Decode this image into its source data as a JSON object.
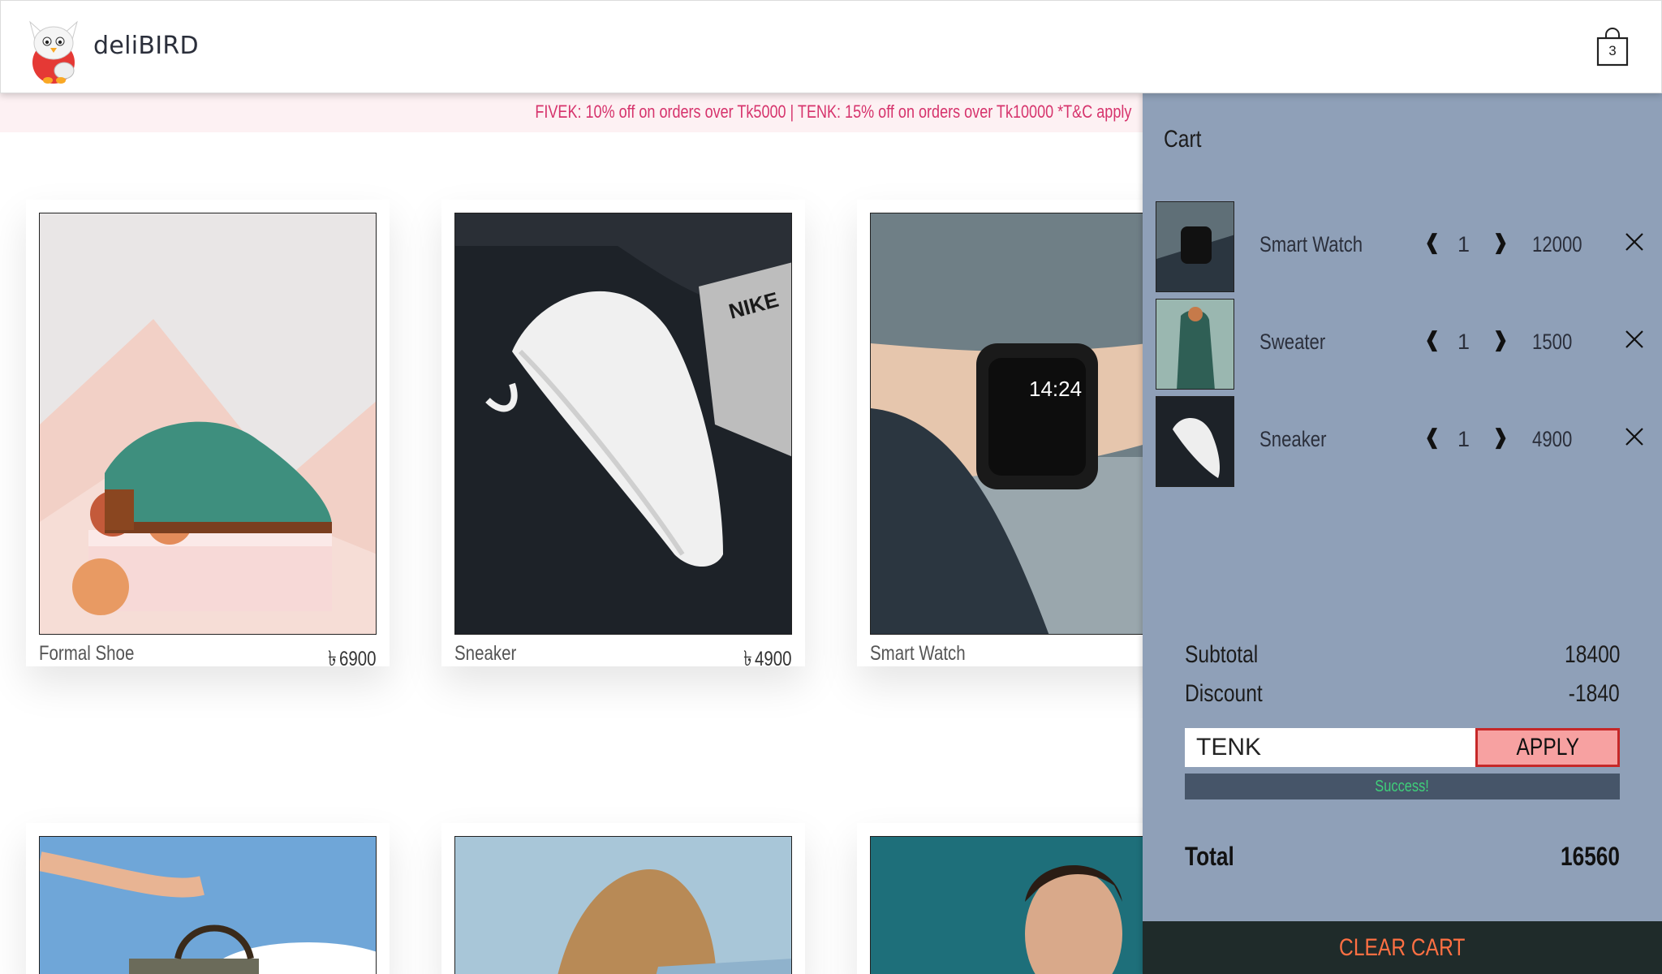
{
  "header": {
    "brand": "deliBIRD",
    "cart_count": "3"
  },
  "promo": {
    "text": "FIVEK: 10% off on orders over Tk5000 | TENK: 15% off on orders over Tk10000 *T&C apply"
  },
  "products": [
    {
      "name": "Formal Shoe",
      "price": "6900",
      "currency_symbol": "৳"
    },
    {
      "name": "Sneaker",
      "price": "4900",
      "currency_symbol": "৳"
    },
    {
      "name": "Smart Watch"
    }
  ],
  "cart": {
    "title": "Cart",
    "items": [
      {
        "name": "Smart Watch",
        "qty": "1",
        "price": "12000"
      },
      {
        "name": "Sweater",
        "qty": "1",
        "price": "1500"
      },
      {
        "name": "Sneaker",
        "qty": "1",
        "price": "4900"
      }
    ],
    "prev_glyph": "❰",
    "next_glyph": "❱",
    "subtotal_label": "Subtotal",
    "subtotal_value": "18400",
    "discount_label": "Discount",
    "discount_value": "-1840",
    "coupon_value": "TENK",
    "apply_label": "APPLY",
    "status_text": "Success!",
    "total_label": "Total",
    "total_value": "16560",
    "clear_label": "CLEAR CART"
  },
  "colors": {
    "cart_bg": "#8fa0b8",
    "promo_text": "#d6336c",
    "success": "#3fcf7a",
    "clear_text": "#ff7043"
  }
}
